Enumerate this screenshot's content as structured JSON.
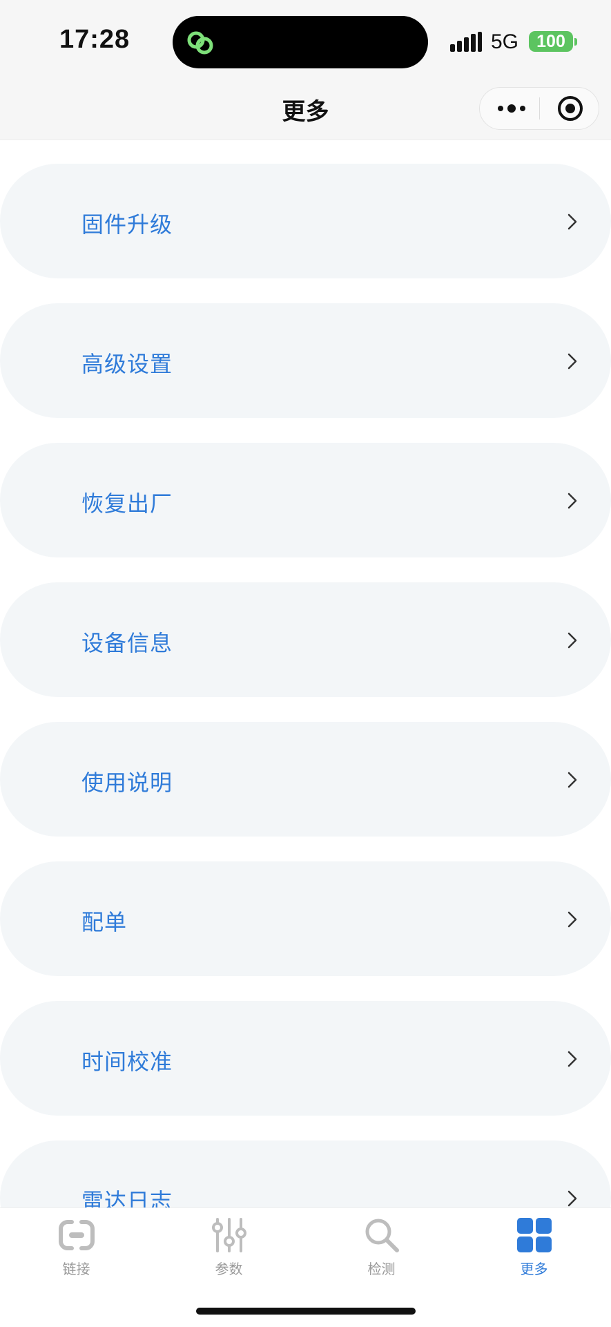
{
  "status_bar": {
    "time": "17:28",
    "network": "5G",
    "battery": "100",
    "colors": {
      "battery": "#5cc460",
      "island_icon": "#7ee07a"
    }
  },
  "nav": {
    "title": "更多"
  },
  "menu": {
    "items": [
      {
        "label": "固件升级",
        "icon": "chevron-right-icon"
      },
      {
        "label": "高级设置",
        "icon": "chevron-right-icon"
      },
      {
        "label": "恢复出厂",
        "icon": "chevron-right-icon"
      },
      {
        "label": "设备信息",
        "icon": "chevron-right-icon"
      },
      {
        "label": "使用说明",
        "icon": "chevron-right-icon"
      },
      {
        "label": "配单",
        "icon": "chevron-right-icon"
      },
      {
        "label": "时间校准",
        "icon": "chevron-right-icon"
      },
      {
        "label": "雷达日志",
        "icon": "chevron-right-icon"
      }
    ],
    "colors": {
      "label": "#2f7bd9",
      "background": "#f3f6f8"
    }
  },
  "tabbar": {
    "tabs": [
      {
        "label": "链接",
        "icon": "link-icon",
        "active": false
      },
      {
        "label": "参数",
        "icon": "sliders-icon",
        "active": false
      },
      {
        "label": "检测",
        "icon": "search-icon",
        "active": false
      },
      {
        "label": "更多",
        "icon": "grid-icon",
        "active": true
      }
    ],
    "colors": {
      "active": "#2f7bd9",
      "inactive": "#999999"
    }
  }
}
